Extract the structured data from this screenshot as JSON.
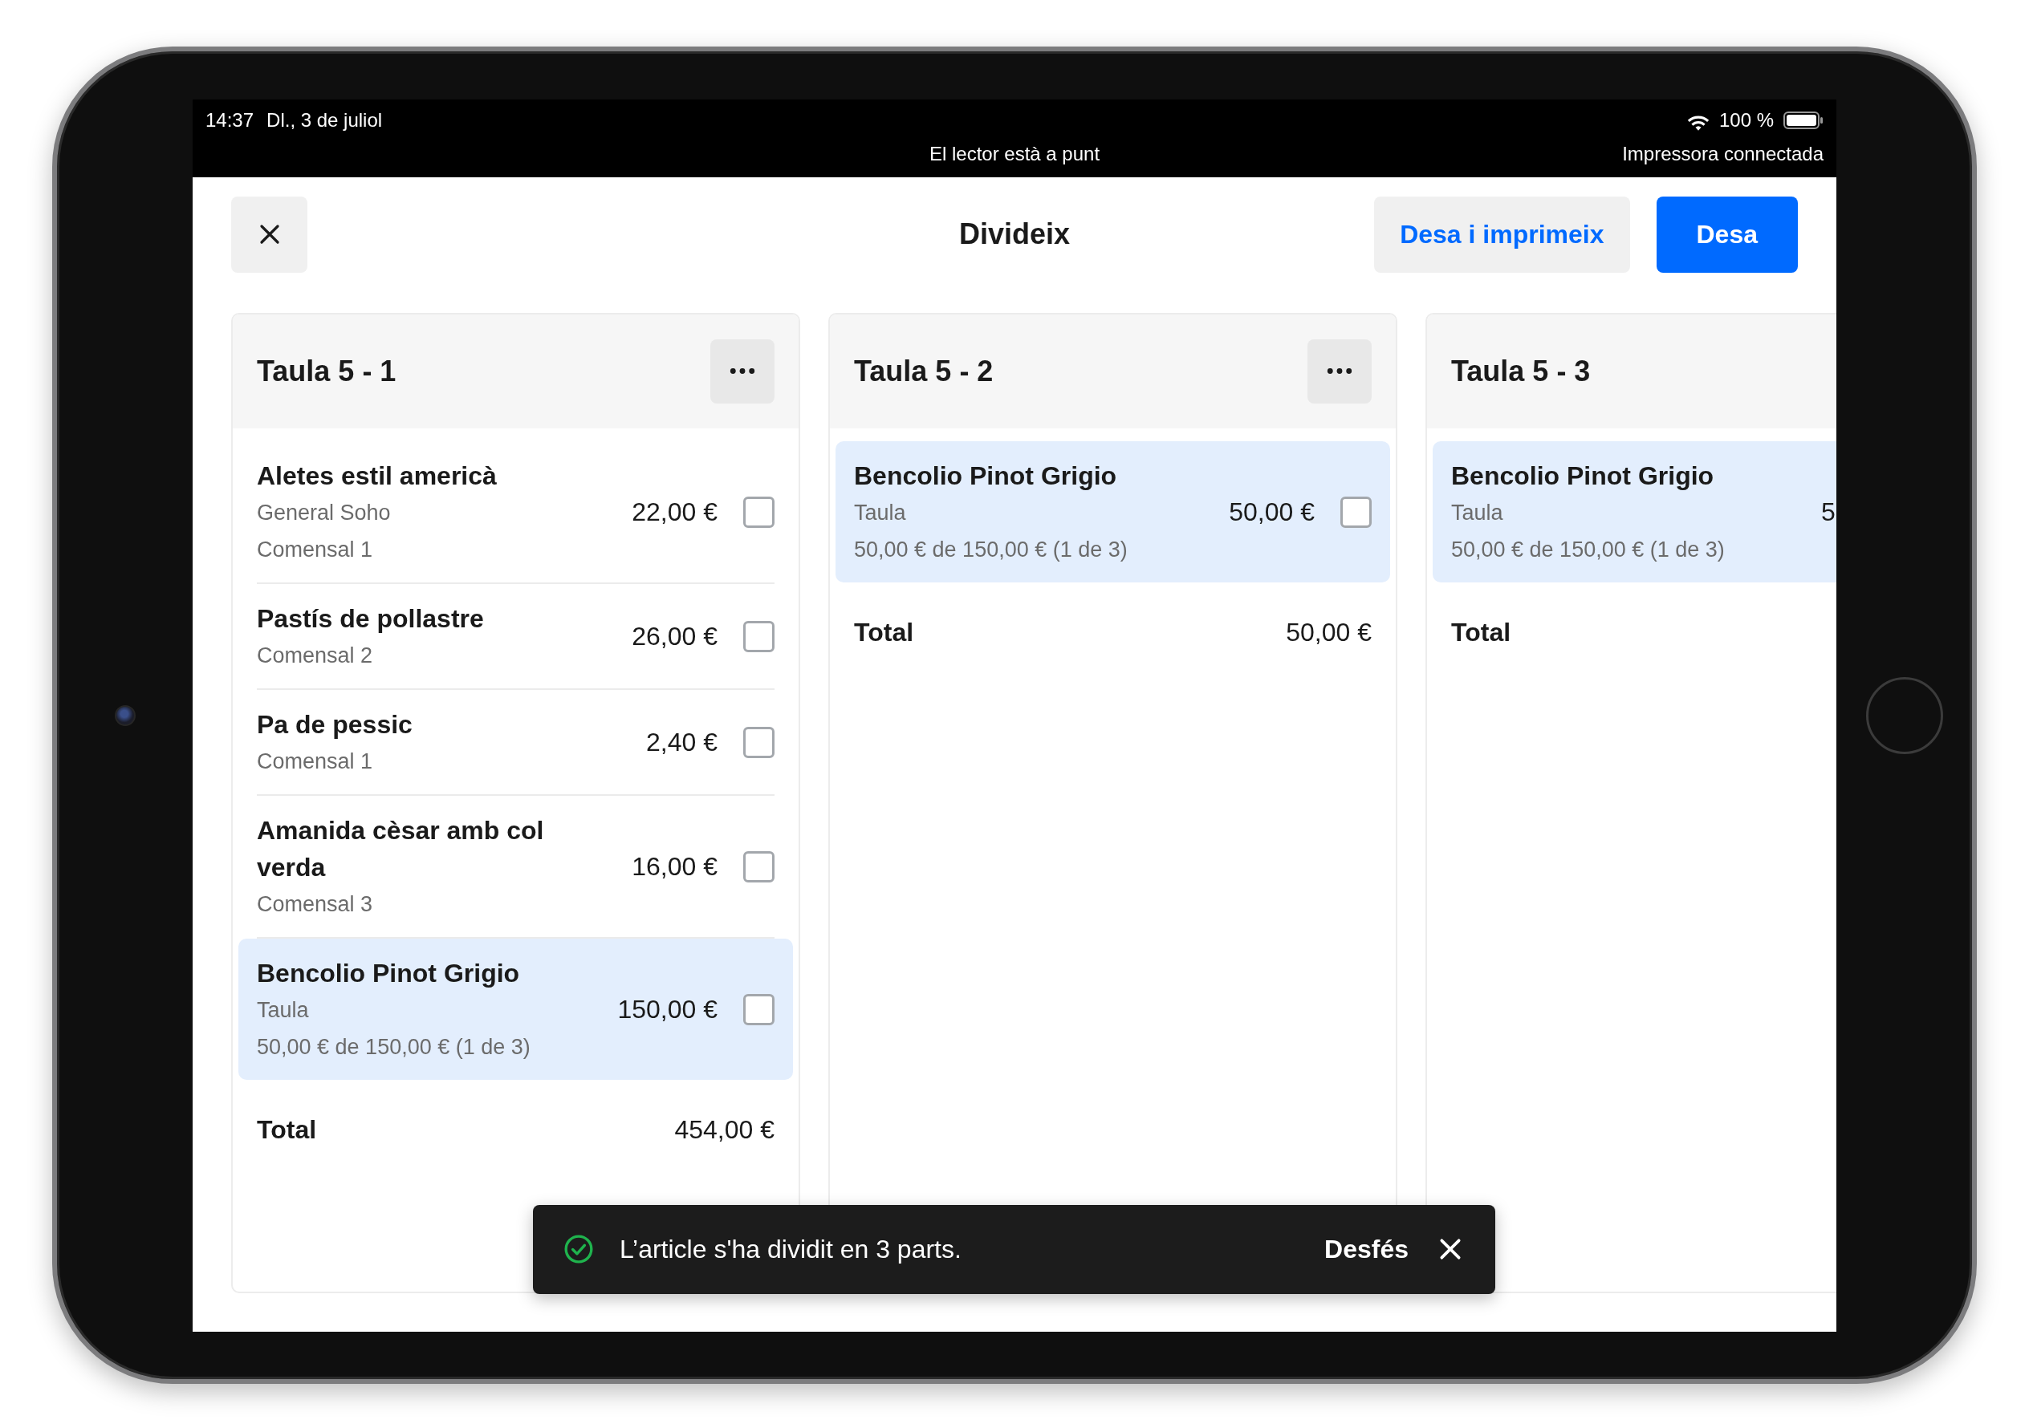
{
  "status_bar": {
    "time": "14:37",
    "date": "Dl., 3 de juliol",
    "battery": "100 %",
    "center_message": "El lector està a punt",
    "right_message": "Impressora connectada"
  },
  "header": {
    "title": "Divideix",
    "buttons": [
      {
        "label": "Desa i imprimeix",
        "kind": "secondary"
      },
      {
        "label": "Desa",
        "kind": "primary"
      }
    ]
  },
  "columns": [
    {
      "title": "Taula 5 - 1",
      "menu": true,
      "cut_off": false,
      "items": [
        {
          "name": "Aletes estil americà",
          "details": [
            "General Soho",
            "Comensal 1"
          ],
          "price": "22,00 €",
          "highlighted": false,
          "checked": false
        },
        {
          "name": "Pastís de pollastre",
          "details": [
            "Comensal 2"
          ],
          "price": "26,00 €",
          "highlighted": false,
          "checked": false
        },
        {
          "name": "Pa de pessic",
          "details": [
            "Comensal 1"
          ],
          "price": "2,40 €",
          "highlighted": false,
          "checked": false
        },
        {
          "name": "Amanida cèsar amb col verda",
          "details": [
            "Comensal 3"
          ],
          "price": "16,00 €",
          "highlighted": false,
          "checked": false
        },
        {
          "name": "Bencolio Pinot Grigio",
          "details": [
            "Taula",
            "50,00 € de 150,00 € (1 de 3)"
          ],
          "price": "150,00 €",
          "highlighted": true,
          "checked": false
        }
      ],
      "total": {
        "label": "Total",
        "value": "454,00 €"
      }
    },
    {
      "title": "Taula 5 - 2",
      "menu": true,
      "cut_off": false,
      "items": [
        {
          "name": "Bencolio Pinot Grigio",
          "details": [
            "Taula",
            "50,00 € de 150,00 € (1 de 3)"
          ],
          "price": "50,00 €",
          "highlighted": true,
          "checked": false
        }
      ],
      "total": {
        "label": "Total",
        "value": "50,00 €"
      }
    },
    {
      "title": "Taula 5 - 3",
      "menu": false,
      "cut_off": true,
      "items": [
        {
          "name": "Bencolio Pinot Grigio",
          "details": [
            "Taula",
            "50,00 € de 150,00 € (1 de 3)"
          ],
          "price": "5",
          "highlighted": true
        }
      ],
      "total": {
        "label": "Total"
      }
    }
  ],
  "toast": {
    "message": "L’article s'ha dividit en 3 parts.",
    "action": "Desfés"
  }
}
